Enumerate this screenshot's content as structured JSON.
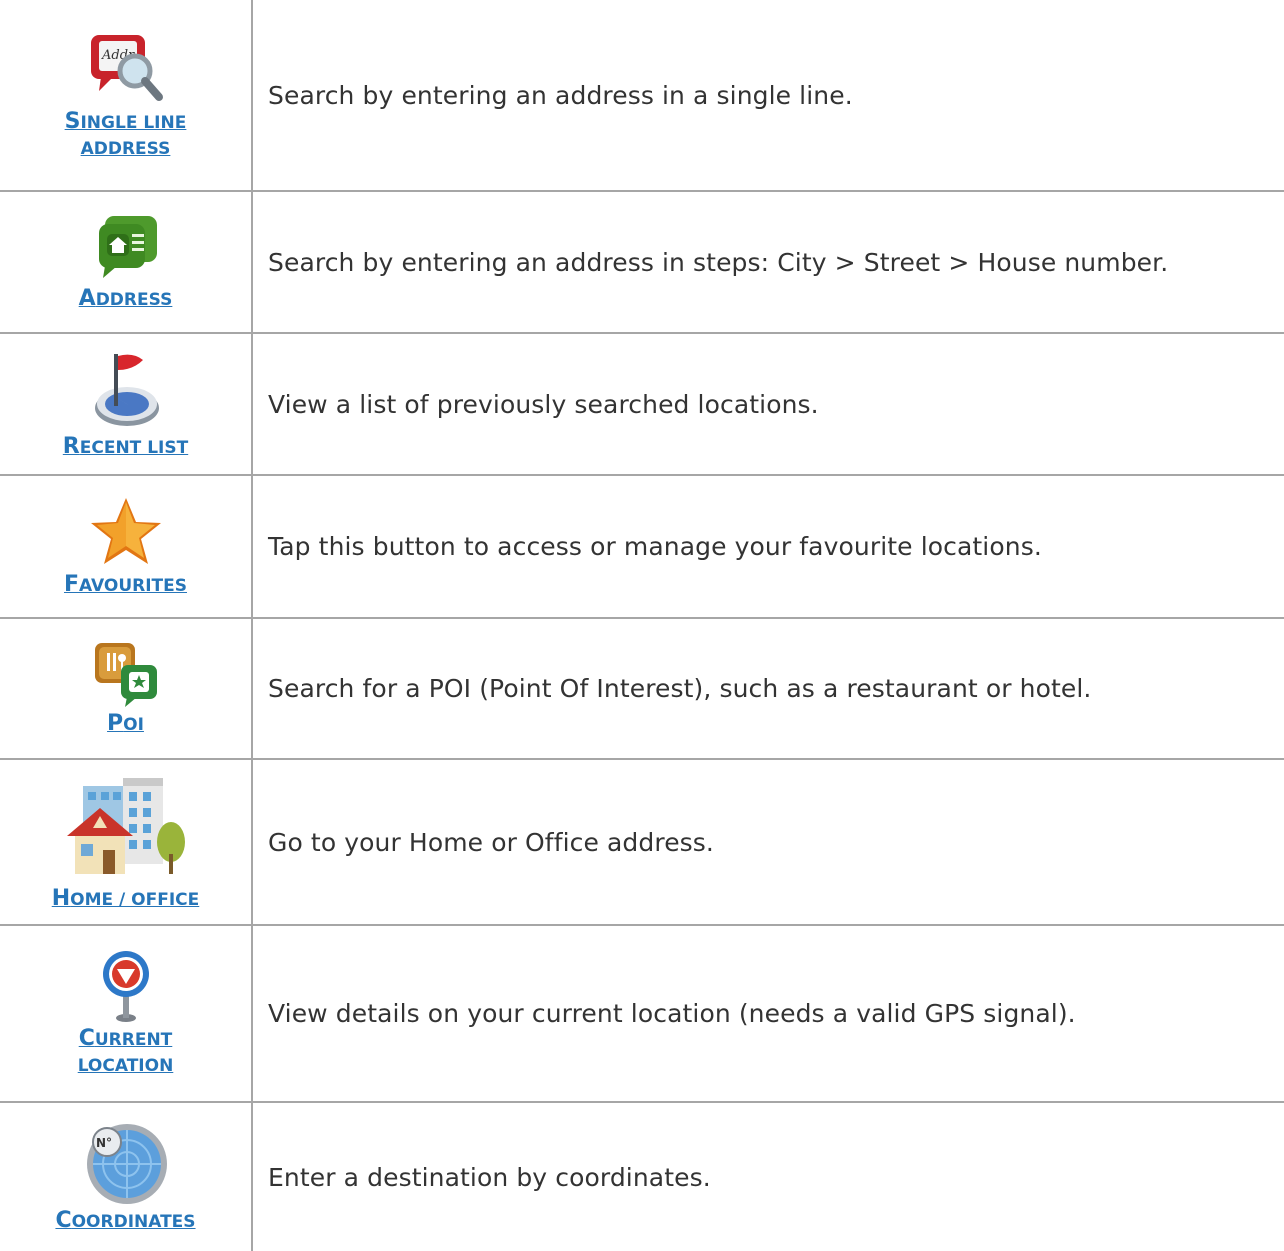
{
  "rows": [
    {
      "label_lines": [
        "Single Line",
        "Address"
      ],
      "description": "Search by entering an address in a single line.",
      "icon": "single-line-address-icon"
    },
    {
      "label_lines": [
        "Address"
      ],
      "description": "Search by entering an address in steps: City > Street > House number.",
      "icon": "address-icon"
    },
    {
      "label_lines": [
        "Recent List"
      ],
      "description": "View a list of previously searched locations.",
      "icon": "recent-list-icon"
    },
    {
      "label_lines": [
        "Favourites"
      ],
      "description": "Tap this button to access or manage your favourite locations.",
      "icon": "favourites-star-icon"
    },
    {
      "label_lines": [
        "POI"
      ],
      "description": "Search for a POI (Point Of Interest), such as a restaurant or hotel.",
      "icon": "poi-icon"
    },
    {
      "label_lines": [
        "Home / Office"
      ],
      "description": "Go to your Home or Office address.",
      "icon": "home-office-icon"
    },
    {
      "label_lines": [
        "Current",
        "Location"
      ],
      "description": "View details on your current location (needs a valid GPS signal).",
      "icon": "current-location-icon"
    },
    {
      "label_lines": [
        "Coordinates"
      ],
      "description": "Enter a destination by coordinates.",
      "icon": "coordinates-icon"
    }
  ],
  "icon_text": {
    "address_card": "Addr",
    "coordinates_badge": "N°"
  },
  "colors": {
    "link": "#2675b8",
    "text": "#333333",
    "divider": "#a6a6a6"
  }
}
